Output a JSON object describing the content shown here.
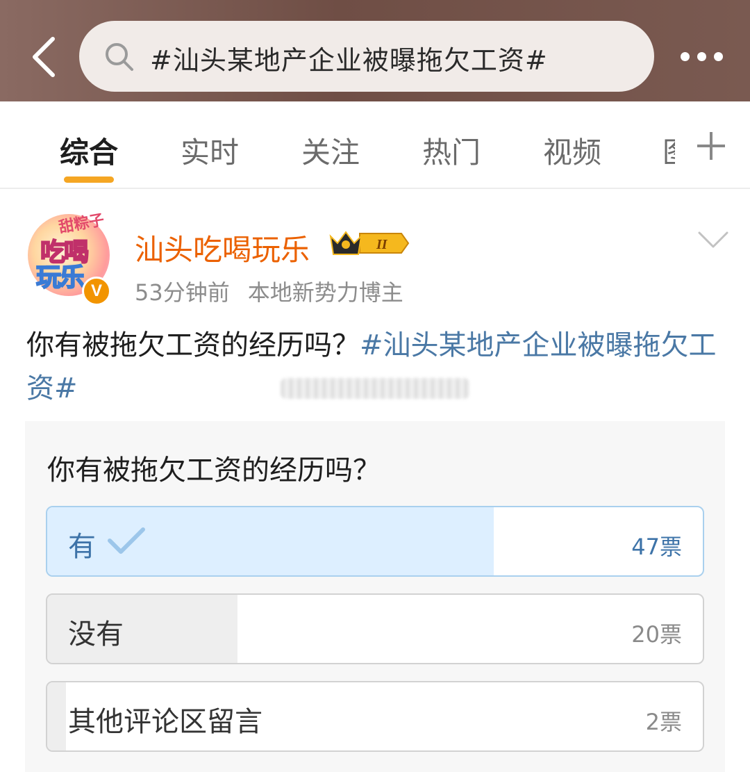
{
  "header": {
    "back_icon": "back-arrow-icon",
    "search_icon": "search-icon",
    "search_query": "#汕头某地产企业被曝拖欠工资#",
    "more_icon": "more-dots-icon",
    "background_color": "#7a5a51"
  },
  "tabs": {
    "items": [
      {
        "label": "综合",
        "active": true
      },
      {
        "label": "实时",
        "active": false
      },
      {
        "label": "关注",
        "active": false
      },
      {
        "label": "热门",
        "active": false
      },
      {
        "label": "视频",
        "active": false
      },
      {
        "label": "图",
        "active": false
      }
    ],
    "add_icon": "plus-icon",
    "accent_color": "#f5a623"
  },
  "post": {
    "author": {
      "name": "汕头吃喝玩乐",
      "avatar_text_top": "甜粽子",
      "avatar_line1": "吃喝",
      "avatar_line2": "玩乐",
      "verified_badge": "V",
      "level_badge": "II",
      "name_color": "#eb6100"
    },
    "time": "53分钟前",
    "source": "本地新势力博主",
    "text": "你有被拖欠工资的经历吗？",
    "topic": "#汕头某地产企业被曝拖欠工资#",
    "topic_color": "#4a78a5"
  },
  "poll": {
    "question": "你有被拖欠工资的经历吗？",
    "options": [
      {
        "label": "有",
        "votes": 47,
        "votes_label": "47票",
        "selected": true,
        "share": 0.681
      },
      {
        "label": "没有",
        "votes": 20,
        "votes_label": "20票",
        "selected": false,
        "share": 0.29
      },
      {
        "label": "其他评论区留言",
        "votes": 2,
        "votes_label": "2票",
        "selected": false,
        "share": 0.029
      }
    ]
  }
}
